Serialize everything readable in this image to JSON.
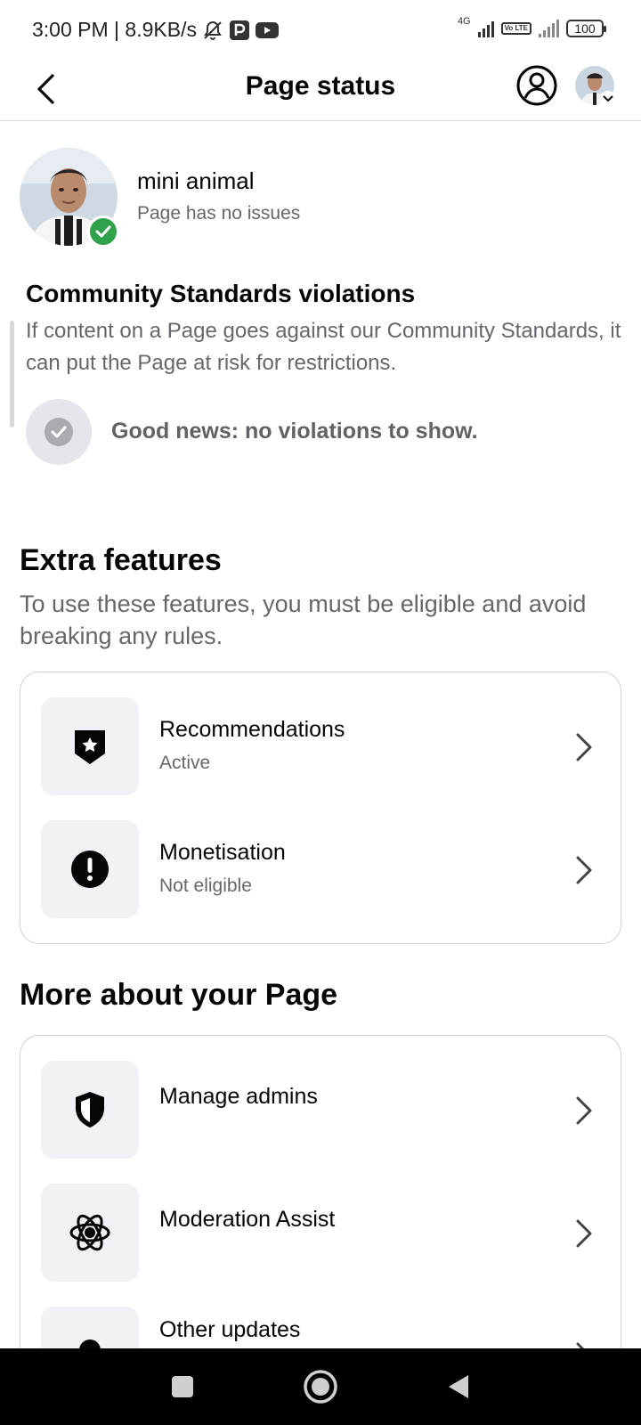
{
  "status_bar": {
    "time_speed": "3:00 PM | 8.9KB/s",
    "network_label": "4G",
    "volte_label": "Vo LTE",
    "battery": "100"
  },
  "header": {
    "title": "Page status"
  },
  "page": {
    "name": "mini animal",
    "status": "Page has no issues"
  },
  "community": {
    "title": "Community Standards violations",
    "description": "If content on a Page goes against our Community Standards, it can put the Page at risk for restrictions.",
    "good_news": "Good news: no violations to show."
  },
  "extra_features": {
    "title": "Extra features",
    "description": "To use these features, you must be eligible and avoid breaking any rules.",
    "items": [
      {
        "label": "Recommendations",
        "status": "Active",
        "icon": "shield-star-icon"
      },
      {
        "label": "Monetisation",
        "status": "Not eligible",
        "icon": "exclamation-icon"
      }
    ]
  },
  "more": {
    "title": "More about your Page",
    "items": [
      {
        "label": "Manage admins",
        "icon": "shield-icon"
      },
      {
        "label": "Moderation Assist",
        "icon": "atom-gear-icon"
      },
      {
        "label": "Other updates",
        "icon": "bell-icon"
      }
    ]
  },
  "colors": {
    "success": "#31a24c",
    "secondary_text": "#65676b",
    "icon_bg": "#f0f2f5"
  }
}
